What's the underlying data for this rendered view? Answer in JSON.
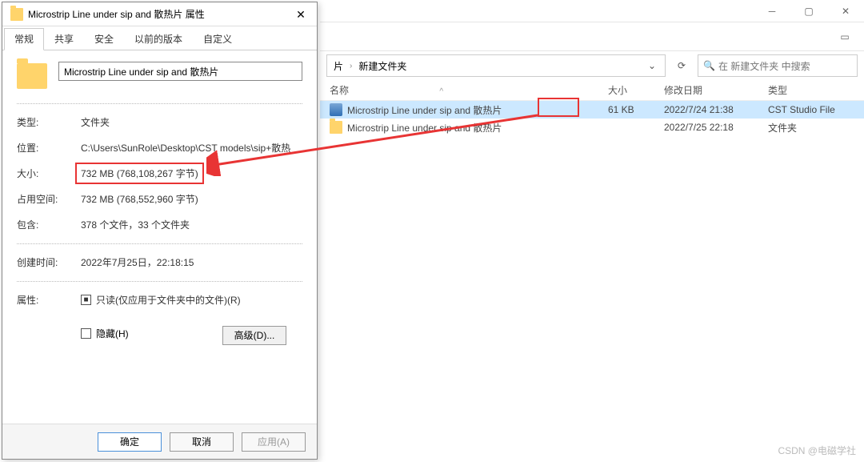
{
  "explorer": {
    "win_buttons": {
      "min": "─",
      "max": "▢",
      "close": "✕"
    },
    "breadcrumb": {
      "truncated_prefix": "片",
      "folder": "新建文件夹"
    },
    "addr_dropdown": "⌄",
    "refresh": "⟳",
    "search_placeholder": "在 新建文件夹 中搜索",
    "columns": {
      "name": "名称",
      "size": "大小",
      "date": "修改日期",
      "type": "类型"
    },
    "sort_arrow": "^",
    "rows": [
      {
        "name": "Microstrip Line under sip and 散热片",
        "size": "61 KB",
        "date": "2022/7/24 21:38",
        "type": "CST Studio File",
        "icon": "cst",
        "selected": true
      },
      {
        "name": "Microstrip Line under sip and 散热片",
        "size": "",
        "date": "2022/7/25 22:18",
        "type": "文件夹",
        "icon": "folder",
        "selected": false
      }
    ]
  },
  "props": {
    "title": "Microstrip Line under sip and 散热片 属性",
    "close": "✕",
    "tabs": [
      "常规",
      "共享",
      "安全",
      "以前的版本",
      "自定义"
    ],
    "active_tab": 0,
    "name_value": "Microstrip Line under sip and 散热片",
    "rows": {
      "type_label": "类型:",
      "type_value": "文件夹",
      "loc_label": "位置:",
      "loc_value": "C:\\Users\\SunRole\\Desktop\\CST models\\sip+散热",
      "size_label": "大小:",
      "size_value": "732 MB (768,108,267 字节)",
      "disk_label": "占用空间:",
      "disk_value": "732 MB (768,552,960 字节)",
      "contains_label": "包含:",
      "contains_value": "378 个文件，33 个文件夹",
      "created_label": "创建时间:",
      "created_value": "2022年7月25日，22:18:15",
      "attr_label": "属性:"
    },
    "readonly_label": "只读(仅应用于文件夹中的文件)(R)",
    "hidden_label": "隐藏(H)",
    "advanced_btn": "高级(D)...",
    "ok_btn": "确定",
    "cancel_btn": "取消",
    "apply_btn": "应用(A)"
  },
  "watermark": "CSDN @电磁学社"
}
